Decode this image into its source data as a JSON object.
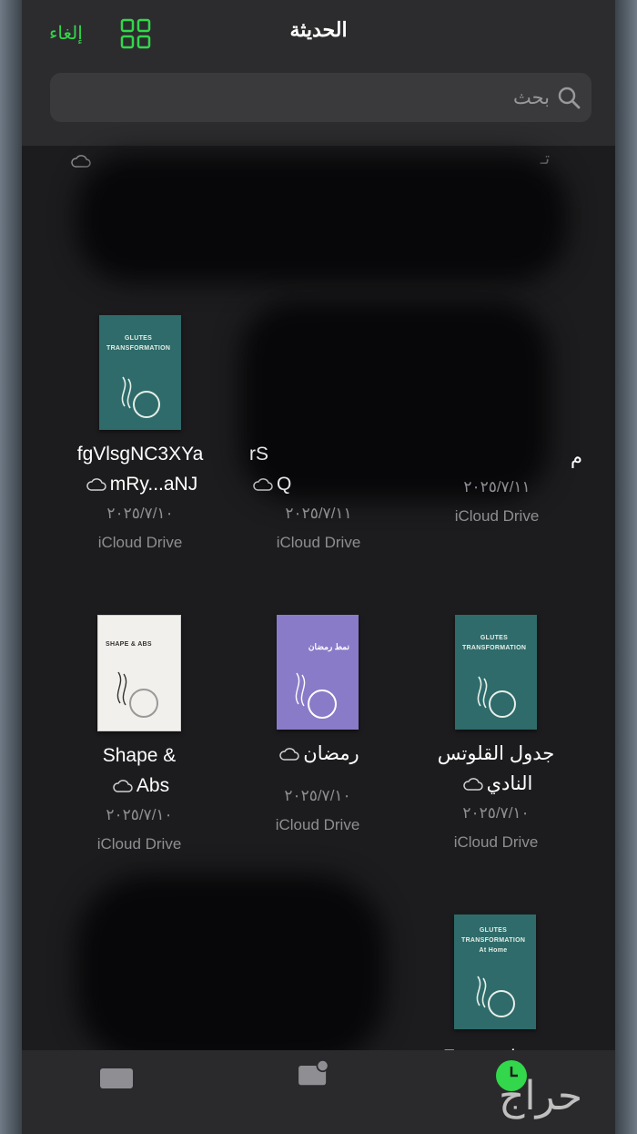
{
  "header": {
    "title": "الحديثة",
    "cancel_label": "إلغاء"
  },
  "search": {
    "placeholder": "بحث"
  },
  "peek_text": "تـ",
  "row1": [
    {
      "name1": "fgVlsgNC3XYa",
      "name2": "mRy...aNJ",
      "date": "٢٠٢٥/٧/١٠",
      "location": "iCloud Drive",
      "cover": "GLUTES TRANSFORMATION"
    },
    {
      "name1": "rS",
      "name2": "Q",
      "date": "٢٠٢٥/٧/١١",
      "location": "iCloud Drive"
    },
    {
      "name1": "م",
      "date": "٢٠٢٥/٧/١١",
      "location": "iCloud Drive"
    }
  ],
  "row2": [
    {
      "name1": "Shape &",
      "name2": "Abs",
      "date": "٢٠٢٥/٧/١٠",
      "location": "iCloud Drive",
      "cover": "SHAPE & ABS"
    },
    {
      "name1": "رمضان",
      "date": "٢٠٢٥/٧/١٠",
      "location": "iCloud Drive",
      "cover": "نمط رمضان"
    },
    {
      "name1": "جدول القلوتس",
      "name2": "النادي",
      "date": "٢٠٢٥/٧/١٠",
      "location": "iCloud Drive",
      "cover": "GLUTES TRANSFORMATION"
    }
  ],
  "row3": [
    {
      "name1": "Fas workout",
      "cover": "GLUTES TRANSFORMATION",
      "cover_sub": "At Home"
    }
  ],
  "watermark": "حراج",
  "colors": {
    "accent": "#32d74b",
    "background": "#1c1c1e",
    "teal_cover": "#2e6b6a",
    "purple_cover": "#8a7bc8"
  }
}
